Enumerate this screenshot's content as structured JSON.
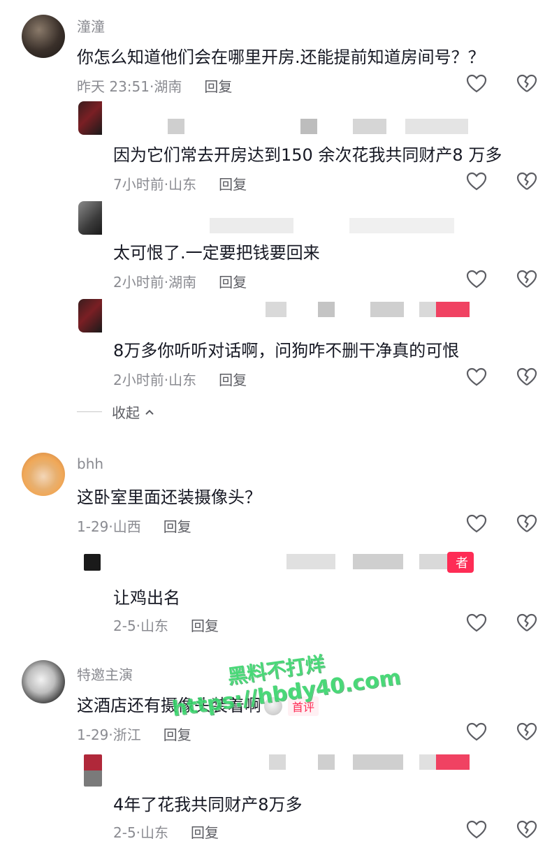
{
  "comments": [
    {
      "username": "潼潼",
      "text": "你怎么知道他们会在哪里开房.还能提前知道房间号？？",
      "time": "昨天 23:51",
      "location": "湖南",
      "reply_label": "回复",
      "replies": [
        {
          "text": "因为它们常去开房达到150 余次花我共同财产8 万多",
          "time": "7小时前",
          "location": "山东",
          "reply_label": "回复"
        },
        {
          "text": "太可恨了.一定要把钱要回来",
          "time": "2小时前",
          "location": "湖南",
          "reply_label": "回复"
        },
        {
          "text": "8万多你听听对话啊，问狗咋不删干净真的可恨",
          "time": "2小时前",
          "location": "山东",
          "reply_label": "回复"
        }
      ]
    },
    {
      "username": "bhh",
      "text": "这卧室里面还装摄像头？",
      "time": "1-29",
      "location": "山西",
      "reply_label": "回复",
      "replies": [
        {
          "text": "让鸡出名",
          "time": "2-5",
          "location": "山东",
          "reply_label": "回复",
          "author_tag": "者"
        }
      ]
    },
    {
      "username": "特邀主演",
      "text": "这酒店还有摄像头装着啊",
      "badge": "首评",
      "time": "1-29",
      "location": "浙江",
      "reply_label": "回复",
      "replies": [
        {
          "text": "4年了花我共同财产8万多",
          "time": "2-5",
          "location": "山东",
          "reply_label": "回复"
        }
      ]
    }
  ],
  "collapse_label": "收起",
  "watermark": {
    "line1": "黑料不打烊",
    "line2": "https://hbdy40.com"
  },
  "icons": {
    "like": "heart-outline-icon",
    "dislike": "broken-heart-icon",
    "collapse": "chevron-up-icon"
  },
  "colors": {
    "text": "#161823",
    "meta": "#8a8b91",
    "accent": "#fe2c55",
    "watermark": "#36d46a"
  }
}
